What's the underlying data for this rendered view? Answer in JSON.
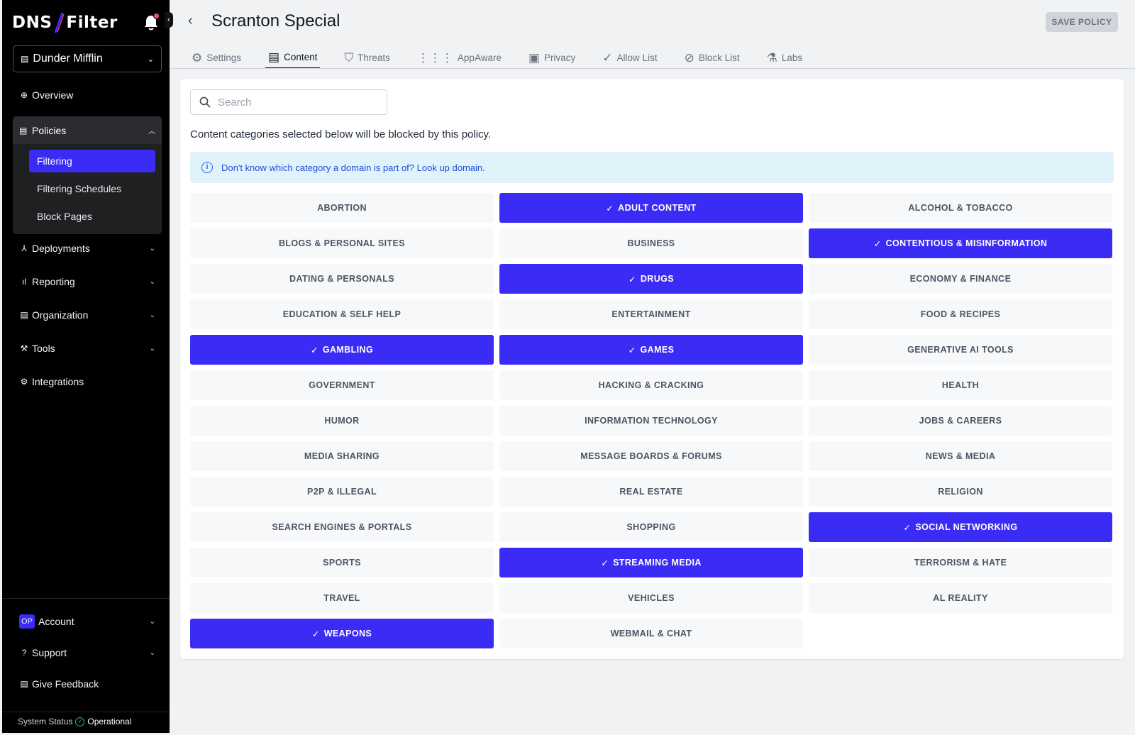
{
  "brand": {
    "logo_text_left": "DNS",
    "logo_text_right": "Filter",
    "accent": "#3b2cf5",
    "notification_dot": "#ec4899"
  },
  "sidebar": {
    "org": "Dunder Mifflin",
    "items": [
      {
        "label": "Overview",
        "icon": "globe-icon"
      },
      {
        "label": "Policies",
        "icon": "policy-icon"
      },
      {
        "label": "Deployments",
        "icon": "deploy-icon"
      },
      {
        "label": "Reporting",
        "icon": "chart-icon"
      },
      {
        "label": "Organization",
        "icon": "building-icon"
      },
      {
        "label": "Tools",
        "icon": "wrench-icon"
      },
      {
        "label": "Integrations",
        "icon": "gears-icon"
      }
    ],
    "policy_sub": [
      "Filtering",
      "Filtering Schedules",
      "Block Pages"
    ],
    "account": {
      "badge": "OP",
      "label": "Account"
    },
    "support": "Support",
    "feedback": "Give Feedback",
    "status_label": "System Status",
    "status_value": "Operational"
  },
  "header": {
    "title": "Scranton Special",
    "save": "SAVE POLICY"
  },
  "tabs": [
    {
      "label": "Settings",
      "icon": "gear-icon"
    },
    {
      "label": "Content",
      "icon": "document-icon"
    },
    {
      "label": "Threats",
      "icon": "shield-icon"
    },
    {
      "label": "AppAware",
      "icon": "grid-icon"
    },
    {
      "label": "Privacy",
      "icon": "privacy-icon"
    },
    {
      "label": "Allow List",
      "icon": "check-circle-icon"
    },
    {
      "label": "Block List",
      "icon": "block-icon"
    },
    {
      "label": "Labs",
      "icon": "flask-icon"
    }
  ],
  "active_tab": "Content",
  "search": {
    "placeholder": "Search"
  },
  "description": "Content categories selected below will be blocked by this policy.",
  "info": {
    "text": "Don't know which category a domain is part of?",
    "link": "Look up domain."
  },
  "categories": [
    {
      "label": "ABORTION",
      "selected": false
    },
    {
      "label": "ADULT CONTENT",
      "selected": true
    },
    {
      "label": "ALCOHOL & TOBACCO",
      "selected": false
    },
    {
      "label": "BLOGS & PERSONAL SITES",
      "selected": false
    },
    {
      "label": "BUSINESS",
      "selected": false
    },
    {
      "label": "CONTENTIOUS & MISINFORMATION",
      "selected": true
    },
    {
      "label": "DATING & PERSONALS",
      "selected": false
    },
    {
      "label": "DRUGS",
      "selected": true
    },
    {
      "label": "ECONOMY & FINANCE",
      "selected": false
    },
    {
      "label": "EDUCATION & SELF HELP",
      "selected": false
    },
    {
      "label": "ENTERTAINMENT",
      "selected": false
    },
    {
      "label": "FOOD & RECIPES",
      "selected": false
    },
    {
      "label": "GAMBLING",
      "selected": true
    },
    {
      "label": "GAMES",
      "selected": true
    },
    {
      "label": "GENERATIVE AI TOOLS",
      "selected": false
    },
    {
      "label": "GOVERNMENT",
      "selected": false
    },
    {
      "label": "HACKING & CRACKING",
      "selected": false
    },
    {
      "label": "HEALTH",
      "selected": false
    },
    {
      "label": "HUMOR",
      "selected": false
    },
    {
      "label": "INFORMATION TECHNOLOGY",
      "selected": false
    },
    {
      "label": "JOBS & CAREERS",
      "selected": false
    },
    {
      "label": "MEDIA SHARING",
      "selected": false
    },
    {
      "label": "MESSAGE BOARDS & FORUMS",
      "selected": false
    },
    {
      "label": "NEWS & MEDIA",
      "selected": false
    },
    {
      "label": "P2P & ILLEGAL",
      "selected": false
    },
    {
      "label": "REAL ESTATE",
      "selected": false
    },
    {
      "label": "RELIGION",
      "selected": false
    },
    {
      "label": "SEARCH ENGINES & PORTALS",
      "selected": false
    },
    {
      "label": "SHOPPING",
      "selected": false
    },
    {
      "label": "SOCIAL NETWORKING",
      "selected": true
    },
    {
      "label": "SPORTS",
      "selected": false
    },
    {
      "label": "STREAMING MEDIA",
      "selected": true
    },
    {
      "label": "TERRORISM & HATE",
      "selected": false
    },
    {
      "label": "TRAVEL",
      "selected": false
    },
    {
      "label": "VEHICLES",
      "selected": false
    },
    {
      "label": "AL REALITY",
      "selected": false
    },
    {
      "label": "WEAPONS",
      "selected": true
    },
    {
      "label": "WEBMAIL & CHAT",
      "selected": false
    }
  ]
}
